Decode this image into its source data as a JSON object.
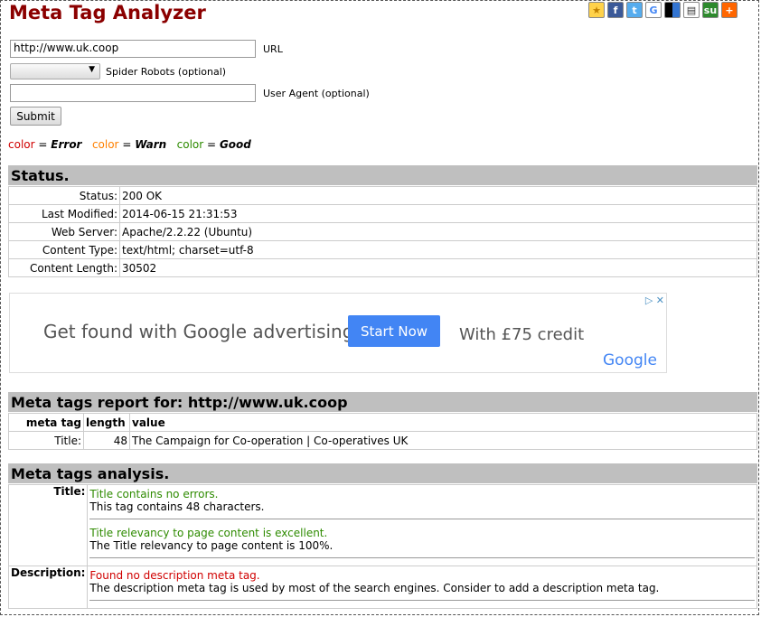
{
  "header": {
    "title": "Meta Tag Analyzer"
  },
  "share_icons": [
    "star-icon",
    "facebook-icon",
    "twitter-icon",
    "google-icon",
    "delicious-icon",
    "digg-icon",
    "stumbleupon-icon",
    "add-icon"
  ],
  "form": {
    "url_value": "http://www.uk.coop",
    "url_label": "URL",
    "spider_value": "",
    "spider_label": "Spider Robots (optional)",
    "ua_value": "",
    "ua_label": "User Agent (optional)",
    "submit_label": "Submit"
  },
  "legend": {
    "color_word": "color",
    "eq": "=",
    "error": "Error",
    "warn": "Warn",
    "good": "Good",
    "colors": {
      "error": "#d00000",
      "warn": "#ff8000",
      "good": "#2e8b00"
    }
  },
  "status": {
    "heading": "Status.",
    "rows": [
      {
        "k": "Status:",
        "v": "200 OK"
      },
      {
        "k": "Last Modified:",
        "v": "2014-06-15 21:31:53"
      },
      {
        "k": "Web Server:",
        "v": "Apache/2.2.22 (Ubuntu)"
      },
      {
        "k": "Content Type:",
        "v": "text/html; charset=utf-8"
      },
      {
        "k": "Content Length:",
        "v": "30502"
      }
    ]
  },
  "ad": {
    "headline": "Get found with Google advertising.",
    "button": "Start Now",
    "credit": "With £75 credit",
    "brand": "Google",
    "close": "▷ ✕"
  },
  "report": {
    "heading": "Meta tags report for: http://www.uk.coop",
    "cols": [
      "meta tag",
      "length",
      "value"
    ],
    "rows": [
      {
        "tag": "Title:",
        "length": "48",
        "value": "The Campaign for Co-operation | Co-operatives UK"
      }
    ]
  },
  "analysis": {
    "heading": "Meta tags analysis.",
    "title_label": "Title:",
    "title_good1": "Title contains no errors.",
    "title_text1": "This tag contains 48 characters.",
    "title_good2": "Title relevancy to page content is excellent.",
    "title_text2": "The Title relevancy to page content is 100%.",
    "desc_label": "Description:",
    "desc_error": "Found no description meta tag.",
    "desc_text": "The description meta tag is used by most of the search engines. Consider to add a description meta tag."
  }
}
